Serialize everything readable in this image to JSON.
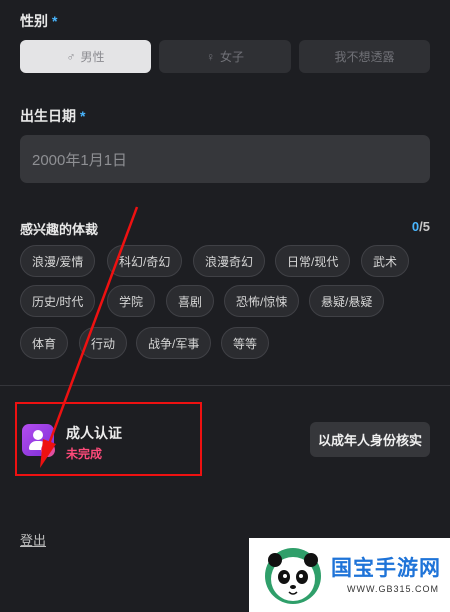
{
  "gender": {
    "label": "性别",
    "required_mark": "*",
    "options": [
      {
        "label": "男性",
        "icon": "male-icon",
        "selected": true
      },
      {
        "label": "女子",
        "icon": "female-icon",
        "selected": false
      },
      {
        "label": "我不想透露",
        "selected": false
      }
    ]
  },
  "birthdate": {
    "label": "出生日期",
    "required_mark": "*",
    "placeholder": "2000年1月1日"
  },
  "genres": {
    "label": "感兴趣的体裁",
    "count_current": "0",
    "count_total": "/5",
    "tags": [
      "浪漫/爱情",
      "科幻/奇幻",
      "浪漫奇幻",
      "日常/现代",
      "武术",
      "历史/时代",
      "学院",
      "喜剧",
      "恐怖/惊悚",
      "悬疑/悬疑",
      "体育",
      "行动",
      "战争/军事",
      "等等"
    ]
  },
  "adult_verification": {
    "title": "成人认证",
    "status": "未完成",
    "button_label": "以成年人身份核实"
  },
  "logout_label": "登出",
  "watermark": {
    "name": "国宝手游网",
    "url": "WWW.GB315.COM"
  },
  "colors": {
    "background": "#1d1e22",
    "accent": "#49b6ff",
    "status_incomplete": "#ff4a7a",
    "annotation_red": "#e11"
  }
}
